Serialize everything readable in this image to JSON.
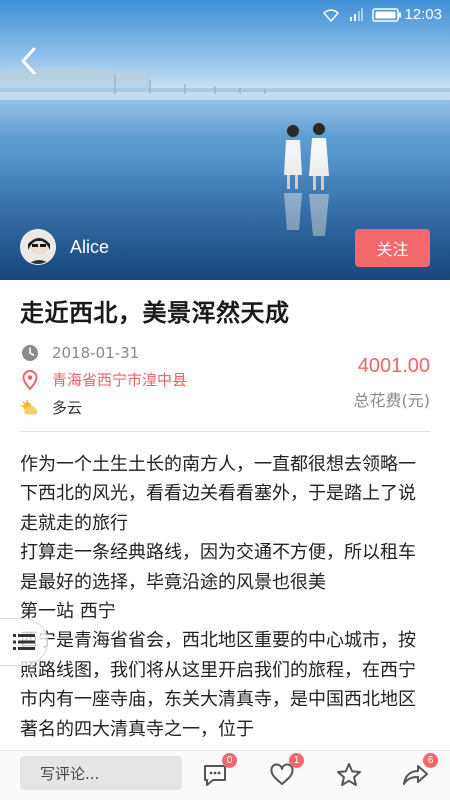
{
  "status_bar": {
    "time": "12:03"
  },
  "author": {
    "name": "Alice"
  },
  "follow_label": "关注",
  "article": {
    "title": "走近西北，美景浑然天成",
    "date": "2018-01-31",
    "location": "青海省西宁市湟中县",
    "weather": "多云",
    "cost_value": "4001.00",
    "cost_label": "总花费(元)",
    "paragraphs": [
      "作为一个土生土长的南方人，一直都很想去领略一下西北的风光，看看边关看看塞外，于是踏上了说走就走的旅行",
      "打算走一条经典路线，因为交通不方便，所以租车是最好的选择，毕竟沿途的风景也很美",
      "第一站 西宁",
      "西宁是青海省省会，西北地区重要的中心城市，按照路线图，我们将从这里开启我们的旅程，在西宁市内有一座寺庙，东关大清真寺，是中国西北地区著名的四大清真寺之一，位于"
    ]
  },
  "bottom_bar": {
    "comment_placeholder": "写评论...",
    "comment_count": "0",
    "like_count": "1",
    "share_count": "6"
  },
  "icons": {
    "back": "back-arrow-icon",
    "clock": "clock-icon",
    "location": "location-pin-icon",
    "weather": "partly-cloudy-icon",
    "toc": "table-of-contents-icon",
    "comment": "comment-bubble-icon",
    "like": "heart-icon",
    "favorite": "star-icon",
    "share": "share-icon"
  },
  "colors": {
    "accent": "#f2686b",
    "muted": "#8a8a8a"
  }
}
